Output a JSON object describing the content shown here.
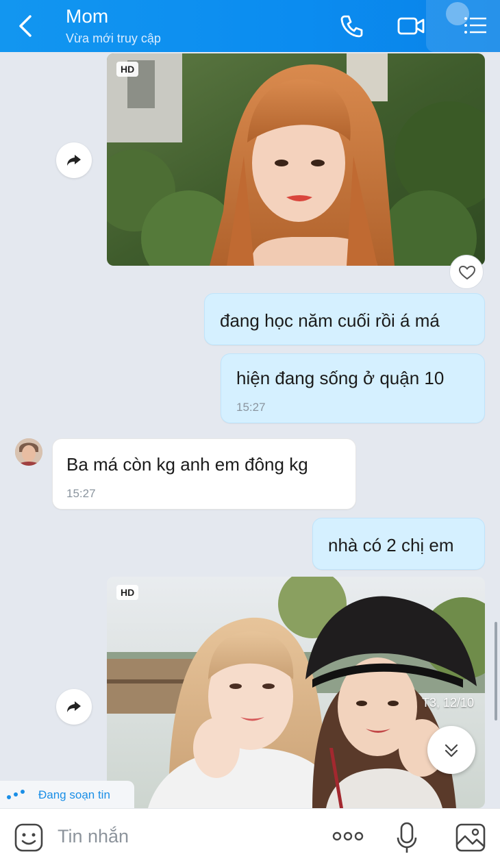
{
  "header": {
    "title": "Mom",
    "status": "Vừa mới truy cập",
    "accent": "#0d8ef0"
  },
  "messages": [
    {
      "type": "image",
      "direction": "outgoing",
      "badge": "HD",
      "content": "woman-with-orange-hair-photo"
    },
    {
      "type": "text",
      "direction": "outgoing",
      "text": "đang học năm cuối rồi á má"
    },
    {
      "type": "text",
      "direction": "outgoing",
      "text": "hiện đang sống ở quận 10",
      "time": "15:27"
    },
    {
      "type": "text",
      "direction": "incoming",
      "text": "Ba má còn kg anh em đông kg",
      "time": "15:27"
    },
    {
      "type": "text",
      "direction": "outgoing",
      "text": "nhà có 2 chị em"
    },
    {
      "type": "image",
      "direction": "outgoing",
      "badge": "HD",
      "date_stamp": "T3, 12/10",
      "content": "two-women-selfie-photo"
    }
  ],
  "typing_indicator": "Đang soạn tin",
  "composer": {
    "placeholder": "Tin nhắn"
  },
  "icons": {
    "back": "chevron-left-icon",
    "call": "phone-icon",
    "video": "video-camera-icon",
    "menu": "list-menu-icon",
    "share": "forward-arrow-icon",
    "react": "heart-icon",
    "scroll": "double-chevron-down-icon",
    "emoji": "sticker-face-icon",
    "more": "more-dots-icon",
    "mic": "microphone-icon",
    "gallery": "image-gallery-icon"
  }
}
